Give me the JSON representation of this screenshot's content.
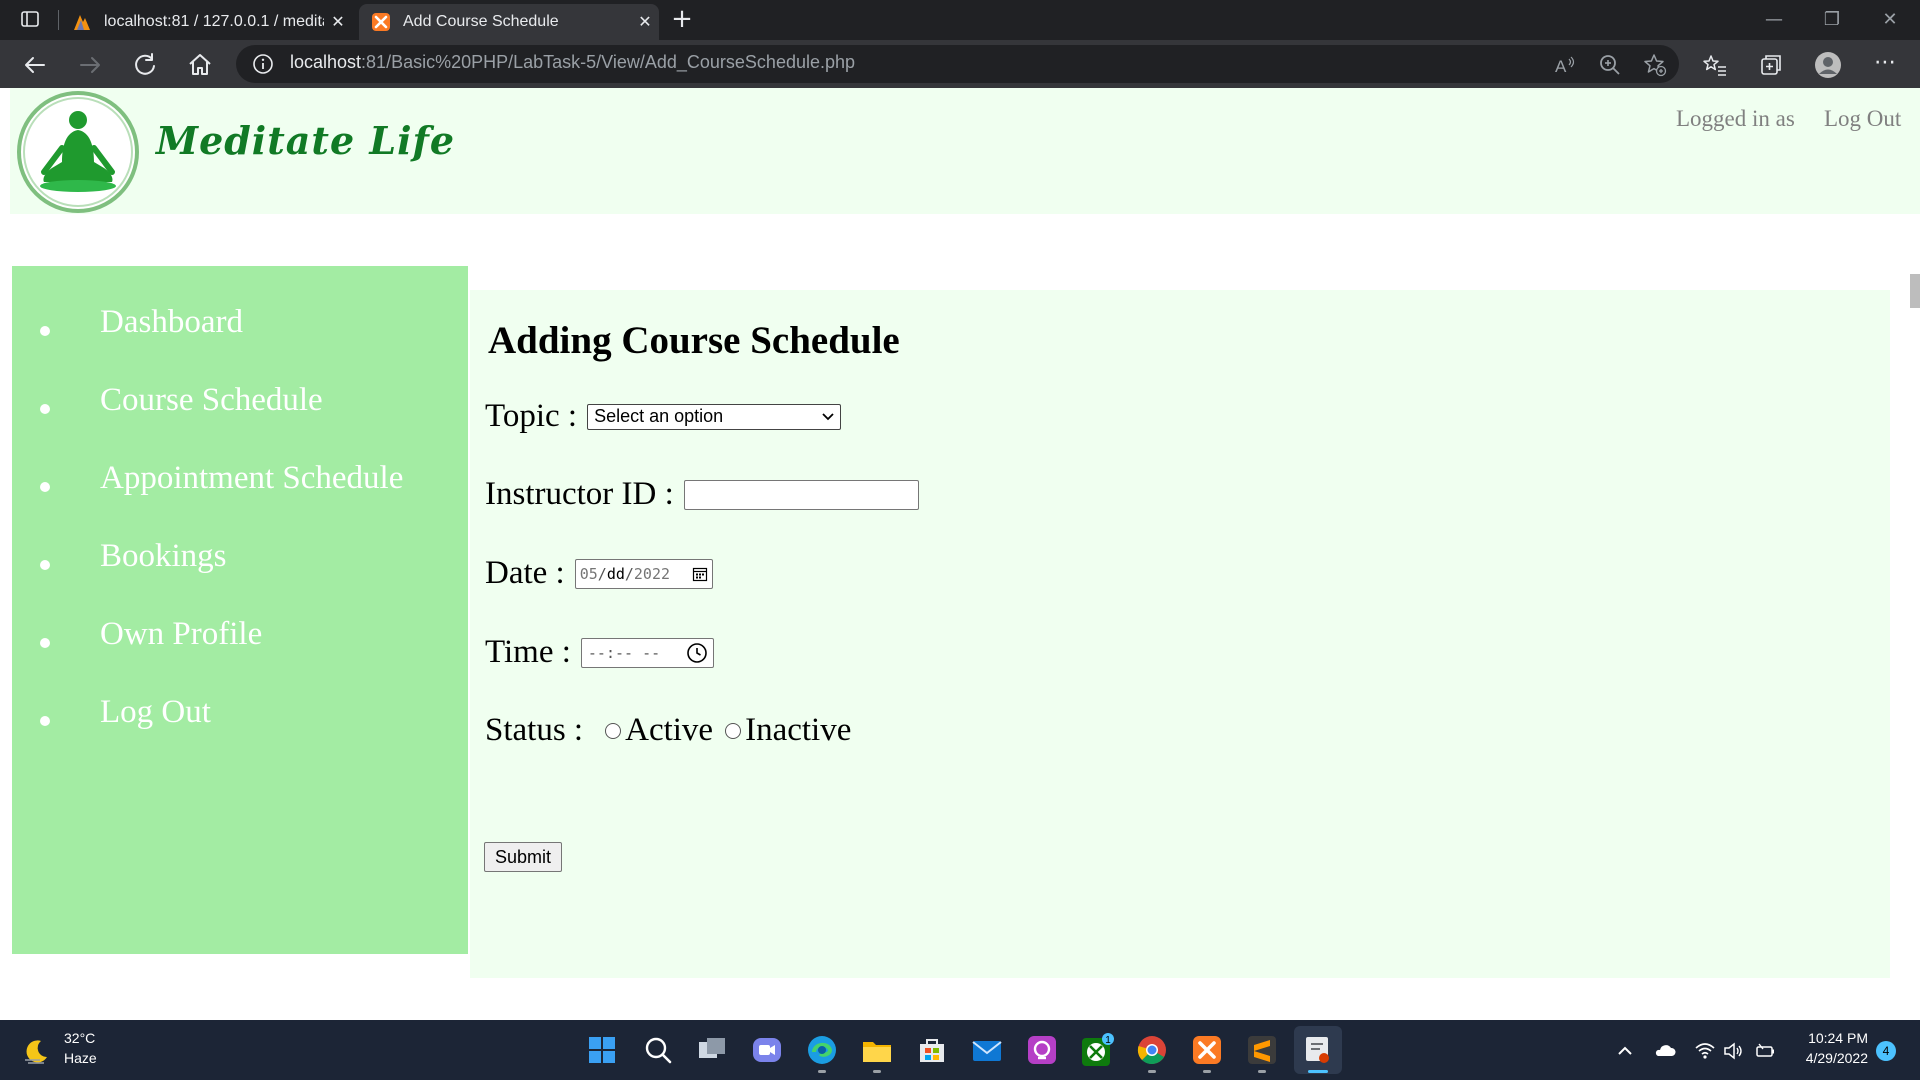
{
  "browser": {
    "tabs": [
      {
        "title": "localhost:81 / 127.0.0.1 / meditat",
        "active": false,
        "favicon": "phpmyadmin-icon"
      },
      {
        "title": "Add Course Schedule",
        "active": true,
        "favicon": "xampp-icon"
      }
    ],
    "url_host": "localhost",
    "url_rest": ":81/Basic%20PHP/LabTask-5/View/Add_CourseSchedule.php"
  },
  "header": {
    "brand": "Meditate Life",
    "logged_in_label": "Logged in as",
    "logout_label": "Log Out"
  },
  "sidebar": {
    "items": [
      {
        "label": "Dashboard"
      },
      {
        "label": "Course Schedule"
      },
      {
        "label": "Appointment Schedule"
      },
      {
        "label": "Bookings"
      },
      {
        "label": "Own Profile"
      },
      {
        "label": "Log Out"
      }
    ]
  },
  "form": {
    "title": "Adding Course Schedule",
    "topic_label": "Topic :",
    "topic_selected": "Select an option",
    "instructor_label": "Instructor ID :",
    "instructor_value": "",
    "date_label": "Date :",
    "date_month": "05",
    "date_day": "dd",
    "date_year": "2022",
    "time_label": "Time :",
    "time_placeholder": "--:-- --",
    "status_label": "Status :",
    "status_options": [
      "Active",
      "Inactive"
    ],
    "submit_label": "Submit"
  },
  "taskbar": {
    "temperature": "32°C",
    "condition": "Haze",
    "time": "10:24 PM",
    "date": "4/29/2022",
    "notification_count": "4",
    "xbox_badge": "1"
  },
  "colors": {
    "header_bg": "#f0fff0",
    "sidebar_bg": "#a3eca3",
    "brand_green": "#117a25"
  }
}
